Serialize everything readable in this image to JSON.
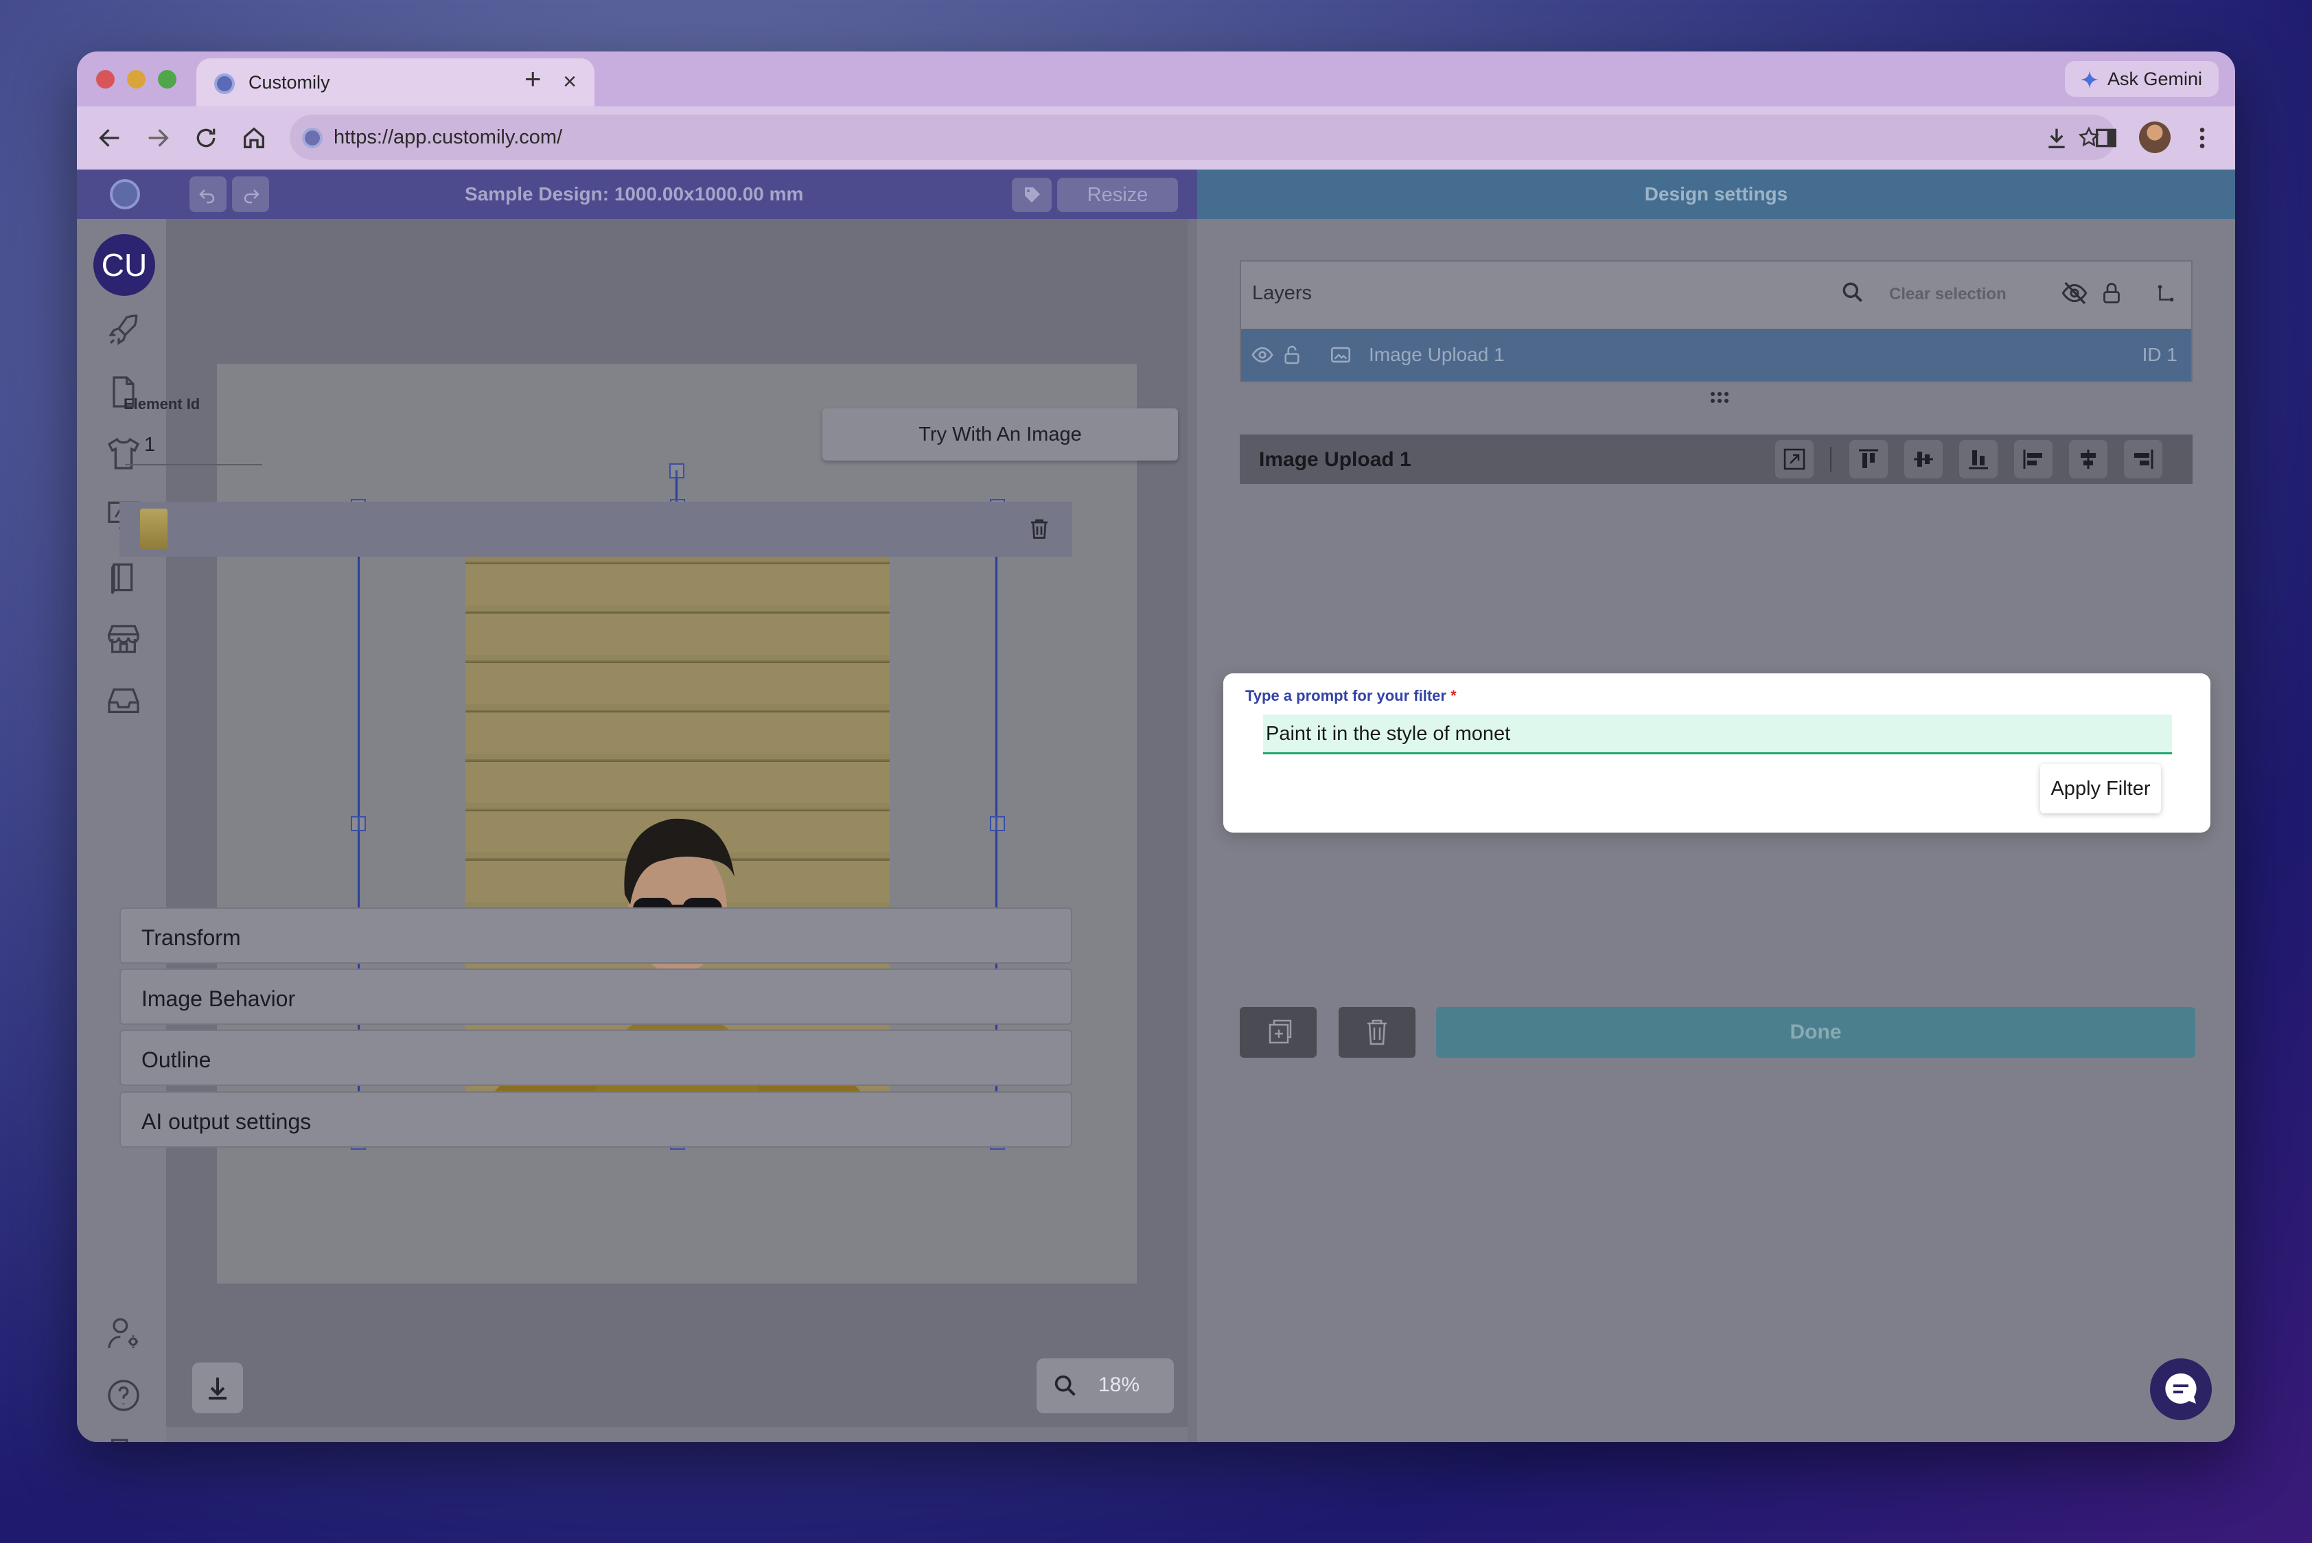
{
  "browser": {
    "tab_title": "Customily",
    "tab_close": "×",
    "new_tab": "+",
    "ask_gemini": "Ask Gemini",
    "url": "https://app.customily.com/"
  },
  "app_header": {
    "design_title": "Sample Design: 1000.00x1000.00 mm",
    "resize_label": "Resize",
    "settings_title": "Design settings"
  },
  "sidebar": {
    "user_initials": "CU"
  },
  "canvas": {
    "zoom_label": "18%"
  },
  "layers": {
    "title": "Layers",
    "clear_selection": "Clear selection",
    "items": [
      {
        "name": "Image Upload 1",
        "id_label": "ID 1"
      }
    ]
  },
  "element": {
    "title": "Image Upload 1",
    "element_id_label": "Element Id",
    "element_id_value": "1",
    "try_button": "Try With An Image"
  },
  "filter": {
    "label": "Type a prompt for your filter",
    "required_mark": "*",
    "value": "Paint it in the style of monet",
    "apply_button": "Apply Filter"
  },
  "sections": [
    "Transform",
    "Image Behavior",
    "Outline",
    "AI output settings"
  ],
  "footer": {
    "done_label": "Done"
  },
  "colors": {
    "header_left": "#4d4a8e",
    "header_right": "#456d8f",
    "done_button": "#4c7f8d",
    "selection": "#2a3f9c",
    "filter_input_bg": "#dff8ee",
    "filter_accent": "#1fa66e"
  }
}
